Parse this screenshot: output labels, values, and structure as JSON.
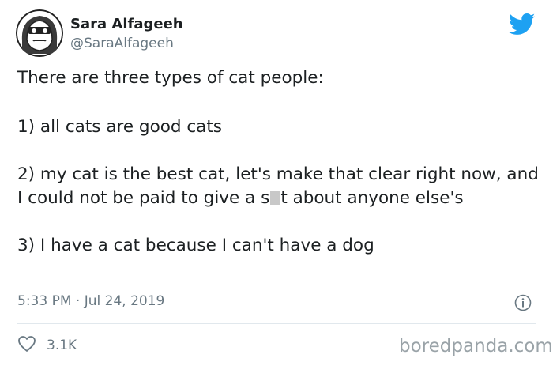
{
  "author": {
    "name": "Sara Alfageeh",
    "handle": "@SaraAlfageeh",
    "avatar_icon": "illustrated-avatar-icon"
  },
  "tweet": {
    "intro": "There are three types of cat people:",
    "item1": "1) all cats are good cats",
    "item2_part1": "2) my cat is the best cat, let's make that clear right now, and I could not be paid to give a s",
    "item2_part2": "t about anyone else's",
    "item3": "3) I have a cat because I can't have a dog"
  },
  "meta": {
    "timestamp": "5:33 PM · Jul 24, 2019",
    "likes": "3.1K"
  },
  "watermark": "boredpanda.com",
  "colors": {
    "twitter_blue": "#1da1f2",
    "secondary_text": "#697882",
    "divider": "#e1e8ed"
  }
}
